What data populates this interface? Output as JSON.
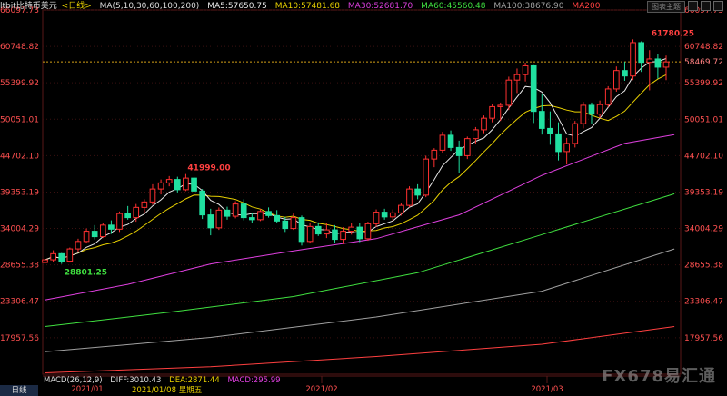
{
  "header": {
    "symbol": "ltbit比特币美元",
    "period": "<日线>",
    "ma_spec": "MA(5,10,30,60,100,200)",
    "items": [
      {
        "label": "MA5:57650.75",
        "color": "#e8e8e8"
      },
      {
        "label": "MA10:57481.68",
        "color": "#e8d000"
      },
      {
        "label": "MA30:52681.70",
        "color": "#e040e0"
      },
      {
        "label": "MA60:45560.48",
        "color": "#40e040"
      },
      {
        "label": "MA100:38676.90",
        "color": "#a0a0a0"
      },
      {
        "label": "MA200",
        "color": "#ff4040"
      }
    ],
    "button_label": "图表主题",
    "window_icons": [
      "minimize-icon",
      "maximize-icon",
      "close-icon"
    ]
  },
  "macd": {
    "items": [
      {
        "label": "MACD(26,12,9)",
        "color": "#dddddd"
      },
      {
        "label": "DIFF:3010.43",
        "color": "#dddddd"
      },
      {
        "label": "DEA:2871.44",
        "color": "#e8d000"
      },
      {
        "label": "MACD:295.99",
        "color": "#e040e0"
      }
    ]
  },
  "footer": {
    "tab_label": "日线",
    "cursor_date": "2021/01/08 星期五"
  },
  "watermark": "FX678易汇通",
  "chart_data": {
    "type": "candlestick",
    "y_ticks": [
      "66097.73",
      "60748.82",
      "55399.92",
      "50051.01",
      "44702.10",
      "39353.19",
      "34004.29",
      "28655.38",
      "23306.47",
      "17957.56"
    ],
    "x_ticks": [
      "2021/01",
      "2021/02",
      "2021/03"
    ],
    "ylim": [
      12600,
      66097.73
    ],
    "current_price": "58469.72",
    "annotations": [
      {
        "text": "41999.00",
        "type": "high",
        "index": 17,
        "price": 41999.0
      },
      {
        "text": "61780.25",
        "type": "high",
        "index": 73,
        "price": 61780.25
      },
      {
        "text": "28801.25",
        "type": "low",
        "index": 2,
        "price": 28801.25
      }
    ],
    "colors": {
      "up": "#ff3030",
      "down": "#20e0a0",
      "ma5": "#e8e8e8",
      "ma10": "#e8d000",
      "ma30": "#e040e0",
      "ma60": "#40e040",
      "ma100": "#a0a0a0",
      "ma200": "#ff4040",
      "grid": "#3a1010",
      "axis_text": "#ff5050"
    },
    "candles": [
      [
        29000,
        29600,
        28700,
        29400
      ],
      [
        29400,
        30800,
        29100,
        30300
      ],
      [
        30300,
        30400,
        28801.25,
        29200
      ],
      [
        29200,
        31200,
        29000,
        31000
      ],
      [
        31000,
        32500,
        30600,
        32100
      ],
      [
        32100,
        34000,
        31800,
        33600
      ],
      [
        33600,
        34500,
        32400,
        32800
      ],
      [
        32800,
        34800,
        32600,
        34500
      ],
      [
        34500,
        35200,
        33200,
        33900
      ],
      [
        33900,
        36500,
        33500,
        36200
      ],
      [
        36200,
        37300,
        35300,
        35600
      ],
      [
        35600,
        37600,
        35000,
        37100
      ],
      [
        37100,
        38300,
        36200,
        37900
      ],
      [
        37900,
        40500,
        37500,
        39800
      ],
      [
        39800,
        41200,
        39000,
        40700
      ],
      [
        40700,
        41700,
        40200,
        41200
      ],
      [
        41200,
        41600,
        39300,
        39700
      ],
      [
        39700,
        41999,
        39500,
        41400
      ],
      [
        41400,
        41600,
        39200,
        39500
      ],
      [
        39500,
        39800,
        35400,
        36000
      ],
      [
        36000,
        36900,
        33000,
        34100
      ],
      [
        34100,
        37100,
        33800,
        36700
      ],
      [
        36700,
        37200,
        35300,
        35800
      ],
      [
        35800,
        38000,
        35500,
        37600
      ],
      [
        37600,
        38300,
        35200,
        35600
      ],
      [
        35600,
        36300,
        34800,
        35300
      ],
      [
        35300,
        36900,
        35100,
        36500
      ],
      [
        36500,
        37100,
        35600,
        35900
      ],
      [
        35900,
        36700,
        34800,
        35100
      ],
      [
        35100,
        35700,
        33500,
        34000
      ],
      [
        34000,
        36200,
        33800,
        35600
      ],
      [
        35600,
        35900,
        31500,
        32100
      ],
      [
        32100,
        34800,
        31800,
        34300
      ],
      [
        34300,
        34900,
        32900,
        33200
      ],
      [
        33200,
        34800,
        32600,
        33800
      ],
      [
        33800,
        34500,
        31900,
        32400
      ],
      [
        32400,
        34200,
        31700,
        33600
      ],
      [
        33600,
        34800,
        33100,
        34200
      ],
      [
        34200,
        34800,
        32000,
        32500
      ],
      [
        32500,
        35000,
        32200,
        34700
      ],
      [
        34700,
        36800,
        34200,
        36400
      ],
      [
        36400,
        36900,
        35300,
        35700
      ],
      [
        35700,
        36800,
        35100,
        36300
      ],
      [
        36300,
        37800,
        35900,
        37400
      ],
      [
        37400,
        40200,
        37100,
        39800
      ],
      [
        39800,
        40500,
        38300,
        38900
      ],
      [
        38900,
        44700,
        38600,
        44200
      ],
      [
        44200,
        45800,
        43000,
        45500
      ],
      [
        45500,
        48200,
        45100,
        47700
      ],
      [
        47700,
        48400,
        45400,
        45900
      ],
      [
        45900,
        46900,
        42100,
        44700
      ],
      [
        44700,
        47500,
        44200,
        47200
      ],
      [
        47200,
        48900,
        46500,
        48500
      ],
      [
        48500,
        50600,
        48000,
        50200
      ],
      [
        50200,
        52300,
        49600,
        51900
      ],
      [
        51900,
        52500,
        49800,
        52100
      ],
      [
        52100,
        56300,
        51400,
        55800
      ],
      [
        55800,
        57500,
        53900,
        56600
      ],
      [
        56600,
        58350,
        55600,
        57900
      ],
      [
        57900,
        58000,
        49500,
        51200
      ],
      [
        51200,
        53800,
        47800,
        48700
      ],
      [
        48700,
        51200,
        46300,
        47900
      ],
      [
        47900,
        49600,
        44000,
        45300
      ],
      [
        45300,
        47300,
        43400,
        46500
      ],
      [
        46500,
        49800,
        45900,
        49400
      ],
      [
        49400,
        52600,
        48700,
        52100
      ],
      [
        52100,
        52500,
        49400,
        50800
      ],
      [
        50800,
        52800,
        50200,
        52200
      ],
      [
        52200,
        54900,
        51800,
        54500
      ],
      [
        54500,
        57800,
        54100,
        57200
      ],
      [
        57200,
        58500,
        55700,
        56400
      ],
      [
        56400,
        61780.25,
        55800,
        61300
      ],
      [
        61300,
        61500,
        57000,
        58400
      ],
      [
        58400,
        60200,
        54300,
        58900
      ],
      [
        58900,
        59600,
        56000,
        57700
      ],
      [
        57700,
        59400,
        55800,
        58469.72
      ]
    ],
    "ma": {
      "ma30": [
        [
          0,
          23500
        ],
        [
          10,
          25800
        ],
        [
          20,
          28800
        ],
        [
          30,
          30700
        ],
        [
          40,
          32500
        ],
        [
          50,
          36000
        ],
        [
          60,
          41800
        ],
        [
          70,
          46500
        ],
        [
          76,
          47800
        ]
      ],
      "ma60": [
        [
          0,
          19600
        ],
        [
          15,
          21700
        ],
        [
          30,
          24000
        ],
        [
          45,
          27500
        ],
        [
          60,
          33100
        ],
        [
          76,
          39100
        ]
      ],
      "ma100": [
        [
          0,
          15900
        ],
        [
          20,
          18000
        ],
        [
          40,
          21000
        ],
        [
          60,
          24800
        ],
        [
          76,
          31000
        ]
      ],
      "ma200": [
        [
          0,
          12800
        ],
        [
          20,
          13700
        ],
        [
          40,
          15200
        ],
        [
          60,
          17000
        ],
        [
          76,
          19600
        ]
      ]
    }
  }
}
